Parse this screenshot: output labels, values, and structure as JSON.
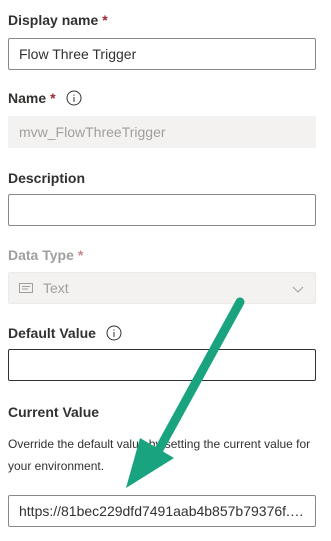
{
  "fields": {
    "display_name": {
      "label": "Display name",
      "required_mark": "*",
      "value": "Flow Three Trigger"
    },
    "name": {
      "label": "Name",
      "required_mark": "*",
      "value": "mvw_FlowThreeTrigger"
    },
    "description": {
      "label": "Description",
      "value": ""
    },
    "data_type": {
      "label": "Data Type",
      "required_mark": "*",
      "value": "Text",
      "icon": "text-type-icon"
    },
    "default_value": {
      "label": "Default Value",
      "value": ""
    },
    "current_value": {
      "label": "Current Value",
      "help": "Override the default value by setting the current value for your environment.",
      "value": "https://81bec229dfd7491aab4b857b79376f.5..."
    }
  },
  "annotation": {
    "arrow_color": "#1aa37f"
  },
  "colors": {
    "required": "#a4262c",
    "disabled_text": "#a19f9d",
    "text": "#323130"
  }
}
